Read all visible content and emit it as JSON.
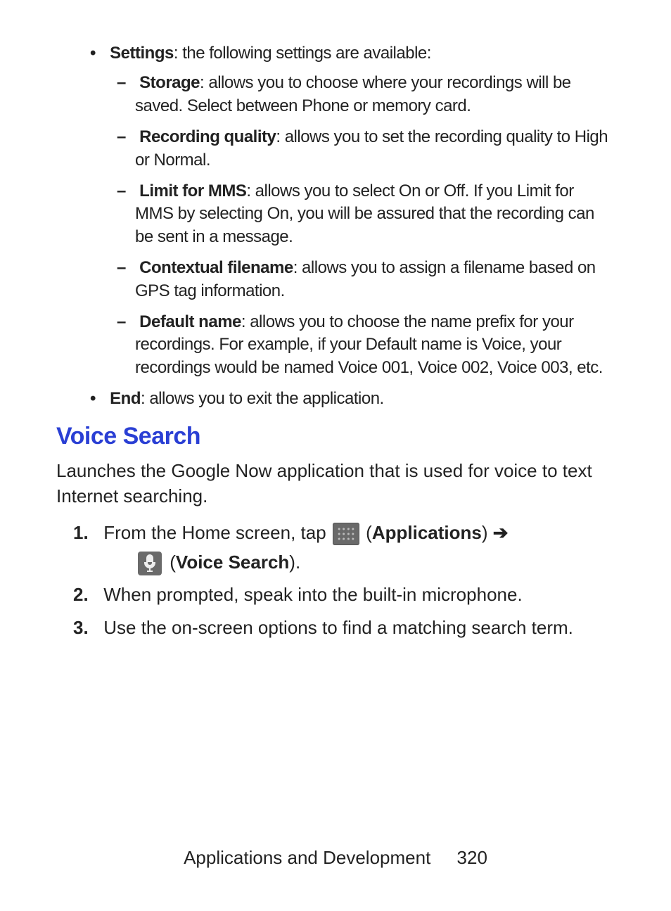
{
  "bullets": {
    "settings": {
      "label": "Settings",
      "text": ": the following settings are available:"
    },
    "end": {
      "label": "End",
      "text": ": allows you to exit the application."
    }
  },
  "dashes": {
    "storage": {
      "label": "Storage",
      "text": ": allows you to choose where your recordings will be saved. Select between Phone or memory card."
    },
    "recording_quality": {
      "label": "Recording quality",
      "text": ": allows you to set the recording quality to High or Normal."
    },
    "limit_mms": {
      "label": "Limit for MMS",
      "text": ": allows you to select On or Off. If you Limit for MMS by selecting On, you will be assured that the recording can be sent in a message."
    },
    "contextual_filename": {
      "label": "Contextual filename",
      "text": ": allows you to assign a filename based on GPS tag information."
    },
    "default_name": {
      "label": "Default name",
      "text": ": allows you to choose the name prefix for your recordings. For example, if your Default name is Voice, your recordings would be named Voice 001, Voice 002, Voice 003, etc."
    }
  },
  "section": {
    "heading": "Voice Search",
    "intro": "Launches the Google Now application that is used for voice to text Internet searching."
  },
  "steps": {
    "s1": {
      "num": "1.",
      "pre": "From the Home screen, tap ",
      "apps_label": "Applications",
      "voice_label": "Voice Search"
    },
    "s2": {
      "num": "2.",
      "text": "When prompted, speak into the built-in microphone."
    },
    "s3": {
      "num": "3.",
      "text": "Use the on-screen options to find a matching search term."
    }
  },
  "footer": {
    "chapter": "Applications and Development",
    "page": "320"
  },
  "glyphs": {
    "arrow": "➔"
  }
}
